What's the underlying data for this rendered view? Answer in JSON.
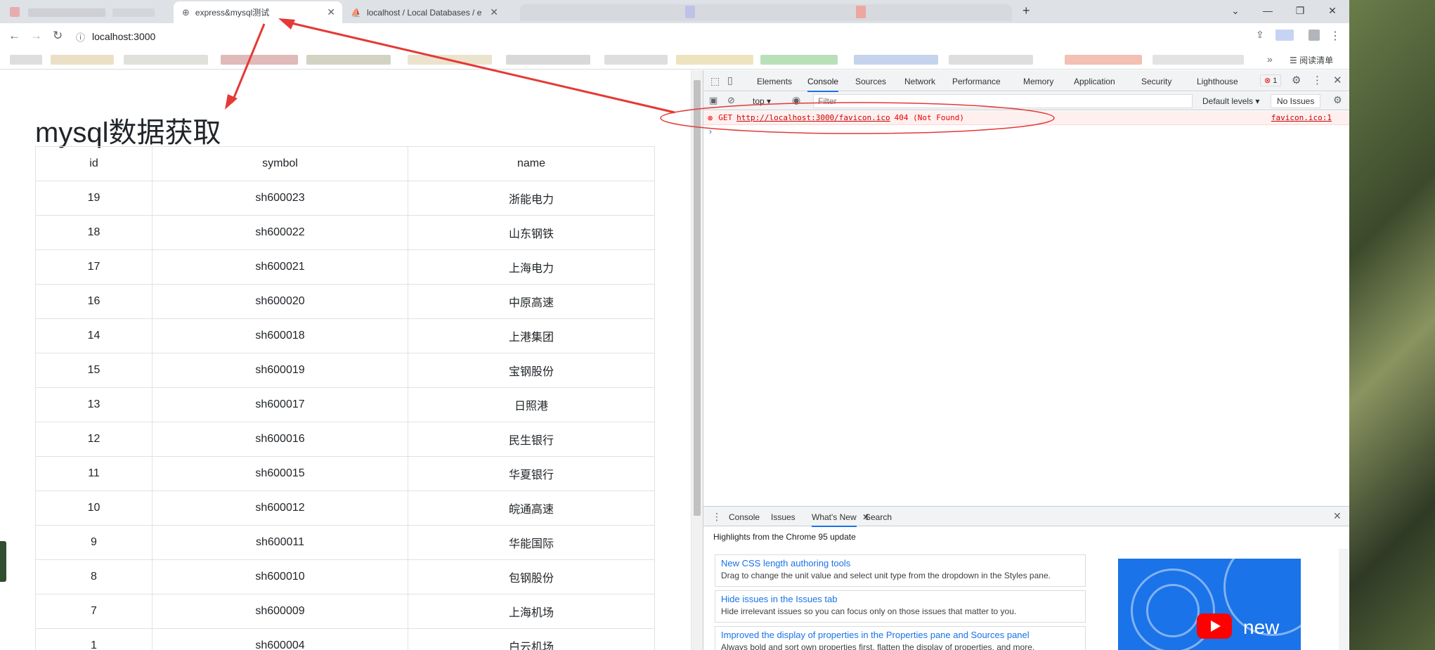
{
  "browser": {
    "tabs": [
      {
        "title": "express&mysql测试"
      },
      {
        "title": "localhost / Local Databases / e"
      }
    ],
    "new_tab": "+",
    "url": "localhost:3000",
    "reading_list": "阅读清单",
    "more_bookmarks": "»"
  },
  "page": {
    "heading": "mysql数据获取",
    "columns": [
      "id",
      "symbol",
      "name"
    ],
    "rows": [
      [
        "19",
        "sh600023",
        "浙能电力"
      ],
      [
        "18",
        "sh600022",
        "山东钢铁"
      ],
      [
        "17",
        "sh600021",
        "上海电力"
      ],
      [
        "16",
        "sh600020",
        "中原高速"
      ],
      [
        "14",
        "sh600018",
        "上港集团"
      ],
      [
        "15",
        "sh600019",
        "宝钢股份"
      ],
      [
        "13",
        "sh600017",
        "日照港"
      ],
      [
        "12",
        "sh600016",
        "民生银行"
      ],
      [
        "11",
        "sh600015",
        "华夏银行"
      ],
      [
        "10",
        "sh600012",
        "皖通高速"
      ],
      [
        "9",
        "sh600011",
        "华能国际"
      ],
      [
        "8",
        "sh600010",
        "包钢股份"
      ],
      [
        "7",
        "sh600009",
        "上海机场"
      ],
      [
        "1",
        "sh600004",
        "白云机场"
      ]
    ]
  },
  "devtools": {
    "tabs": [
      "Elements",
      "Console",
      "Sources",
      "Network",
      "Performance",
      "Memory",
      "Application",
      "Security",
      "Lighthouse"
    ],
    "selected_tab": "Console",
    "error_count": "1",
    "context": "top ▾",
    "filter_placeholder": "Filter",
    "levels": "Default levels ▾",
    "issues": "No Issues",
    "error": {
      "method": "GET",
      "url": "http://localhost:3000/favicon.ico",
      "status": "404 (Not Found)",
      "source": "favicon.ico:1"
    },
    "drawer": {
      "tabs": [
        "Console",
        "Issues",
        "What's New",
        "Search"
      ],
      "selected": "What's New",
      "highlights": "Highlights from the Chrome 95 update",
      "items": [
        {
          "title": "New CSS length authoring tools",
          "desc": "Drag to change the unit value and select unit type from the dropdown in the Styles pane."
        },
        {
          "title": "Hide issues in the Issues tab",
          "desc": "Hide irrelevant issues so you can focus only on those issues that matter to you."
        },
        {
          "title": "Improved the display of properties in the Properties pane and Sources panel",
          "desc": "Always bold and sort own properties first, flatten the display of properties, and more."
        }
      ],
      "promo_text": "new"
    }
  },
  "colors": {
    "accent": "#1a73e8",
    "error": "#e00000",
    "annotation": "#e53935"
  }
}
